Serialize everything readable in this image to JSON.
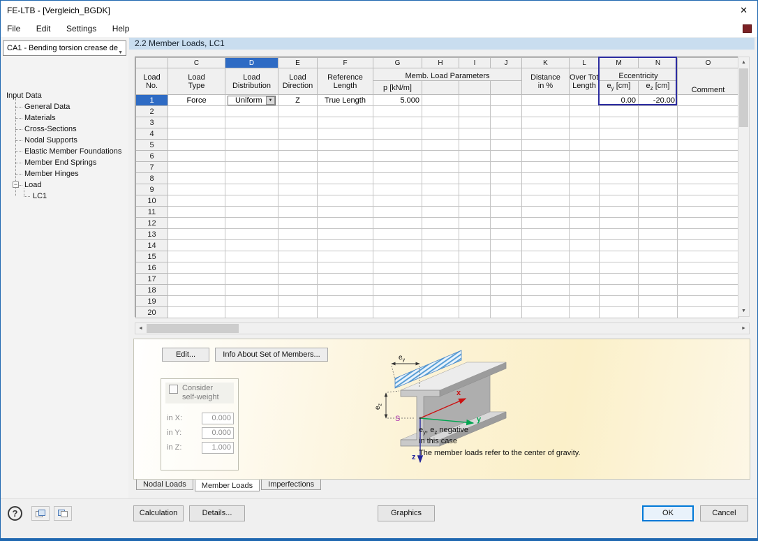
{
  "colors": {
    "accent": "#0078d7",
    "selection_blue": "#2e6bc4",
    "eccentricity_outline": "#2b2ba0",
    "section_header_bg": "#c9ddef",
    "panel_cream": "#fbf0c9"
  },
  "window": {
    "title": "FE-LTB - [Vergleich_BGDK]",
    "close_glyph": "✕"
  },
  "menu": {
    "items": [
      "File",
      "Edit",
      "Settings",
      "Help"
    ]
  },
  "icons": {
    "dropdown": "▼",
    "combo_chevron": "▼",
    "expander_collapse": "−",
    "scroll_up": "▲",
    "scroll_down": "▼",
    "scroll_left": "◄",
    "scroll_right": "►",
    "help": "?"
  },
  "case_combo": {
    "value": "CA1 - Bending torsion crease de"
  },
  "section_title": "2.2 Member Loads, LC1",
  "tree": {
    "root": "Input Data",
    "items": [
      "General Data",
      "Materials",
      "Cross-Sections",
      "Nodal Supports",
      "Elastic Member Foundations",
      "Member End Springs",
      "Member Hinges"
    ],
    "load": {
      "label": "Load",
      "children": [
        "LC1"
      ]
    }
  },
  "table": {
    "letters": [
      "C",
      "D",
      "E",
      "F",
      "G",
      "H",
      "I",
      "J",
      "K",
      "L",
      "M",
      "N",
      "O"
    ],
    "highlight_letter": "D",
    "aligns": [
      "center",
      "center",
      "center",
      "center",
      "right",
      "right",
      "right",
      "right",
      "right",
      "center",
      "right",
      "right",
      "left"
    ],
    "headers": {
      "load_no": [
        "Load",
        "No."
      ],
      "load_type": [
        "Load",
        "Type"
      ],
      "load_distribution": [
        "Load",
        "Distribution"
      ],
      "load_direction": [
        "Load",
        "Direction"
      ],
      "reference_length": [
        "Reference",
        "Length"
      ],
      "memb_group": "Memb. Load Parameters",
      "p_unit": "p [kN/m]",
      "distance": [
        "Distance",
        "in %"
      ],
      "over_total": [
        "Over Total",
        "Length"
      ],
      "eccentricity": "Eccentricity",
      "e_base": "e",
      "e_sub_y": "y",
      "e_sub_z": "z",
      "e_unit": " [cm]",
      "comment": "Comment"
    },
    "rows": [
      {
        "no": "1",
        "selected": true,
        "combo_col": 1,
        "cells": [
          "Force",
          "Uniform",
          "Z",
          "True Length",
          "5.000",
          "",
          "",
          "",
          "",
          "",
          "0.00",
          "-20.00",
          ""
        ]
      },
      {
        "no": "2"
      },
      {
        "no": "3"
      },
      {
        "no": "4"
      },
      {
        "no": "5"
      },
      {
        "no": "6"
      },
      {
        "no": "7"
      },
      {
        "no": "8"
      },
      {
        "no": "9"
      },
      {
        "no": "10"
      },
      {
        "no": "11"
      },
      {
        "no": "12"
      },
      {
        "no": "13"
      },
      {
        "no": "14"
      },
      {
        "no": "15"
      },
      {
        "no": "16"
      },
      {
        "no": "17"
      },
      {
        "no": "18"
      },
      {
        "no": "19"
      },
      {
        "no": "20"
      }
    ]
  },
  "panel": {
    "edit_button": "Edit...",
    "info_button": "Info About Set of Members...",
    "self_weight": {
      "label_line1": "Consider",
      "label_line2": "self-weight",
      "fields": [
        {
          "label": "in X:",
          "value": "0.000"
        },
        {
          "label": "in Y:",
          "value": "0.000"
        },
        {
          "label": "in Z:",
          "value": "1.000"
        }
      ]
    },
    "diagram": {
      "ey_base": "e",
      "ey_sub": "y",
      "ez_base": "e",
      "ez_sub": "z",
      "axis_x": "x",
      "axis_y": "y",
      "axis_z": "z",
      "centroid": "S",
      "note_pre": "e",
      "note_sub1": "y",
      "note_mid": ", e",
      "note_sub2": "z",
      "note_post": " negative",
      "note_line2": "in this case",
      "footnote": "The member loads refer to the center of gravity."
    }
  },
  "tabs": {
    "items": [
      {
        "label": "Nodal Loads",
        "active": false
      },
      {
        "label": "Member Loads",
        "active": true
      },
      {
        "label": "Imperfections",
        "active": false
      }
    ]
  },
  "footer": {
    "calculation": "Calculation",
    "details": "Details...",
    "graphics": "Graphics",
    "ok": "OK",
    "cancel": "Cancel"
  }
}
